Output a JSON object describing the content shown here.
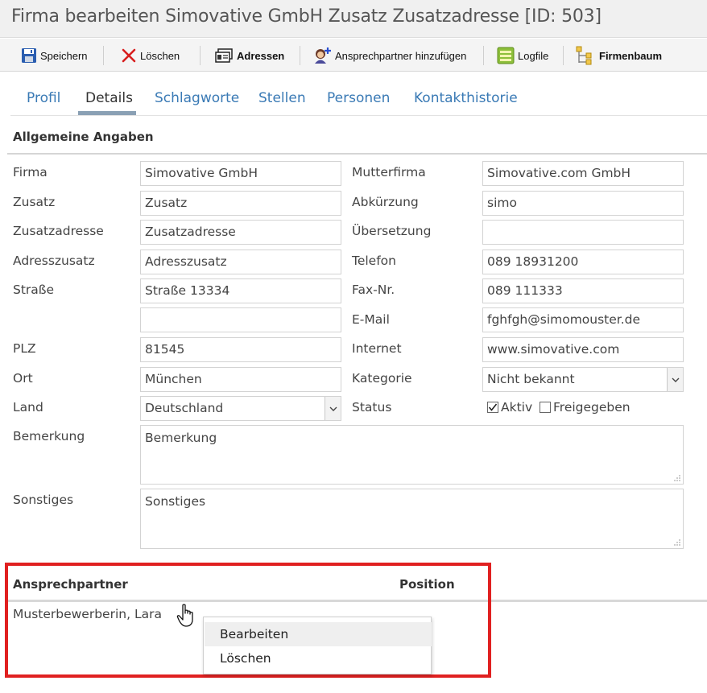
{
  "window": {
    "title": "Firma bearbeiten Simovative GmbH Zusatz Zusatzadresse [ID: 503]"
  },
  "toolbar": {
    "save": {
      "label": "Speichern",
      "icon": "floppy-disk-icon"
    },
    "delete": {
      "label": "Löschen",
      "icon": "red-x-icon"
    },
    "addresses": {
      "label": "Adressen",
      "icon": "address-cards-icon"
    },
    "add_contact": {
      "label": "Ansprechpartner hinzufügen",
      "icon": "add-person-icon"
    },
    "logfile": {
      "label": "Logfile",
      "icon": "list-icon"
    },
    "company_tree": {
      "label": "Firmenbaum",
      "icon": "tree-icon"
    }
  },
  "tabs": [
    {
      "label": "Profil",
      "active": false
    },
    {
      "label": "Details",
      "active": true
    },
    {
      "label": "Schlagworte",
      "active": false
    },
    {
      "label": "Stellen",
      "active": false
    },
    {
      "label": "Personen",
      "active": false
    },
    {
      "label": "Kontakthistorie",
      "active": false
    }
  ],
  "section": {
    "title": "Allgemeine Angaben"
  },
  "form": {
    "firma": {
      "label": "Firma",
      "value": "Simovative GmbH"
    },
    "zusatz": {
      "label": "Zusatz",
      "value": "Zusatz"
    },
    "zusatzadresse": {
      "label": "Zusatzadresse",
      "value": "Zusatzadresse"
    },
    "adresszusatz": {
      "label": "Adresszusatz",
      "value": "Adresszusatz"
    },
    "strasse": {
      "label": "Straße",
      "value": "Straße 13334"
    },
    "strasse2": {
      "label": "",
      "value": ""
    },
    "plz": {
      "label": "PLZ",
      "value": "81545"
    },
    "ort": {
      "label": "Ort",
      "value": "München"
    },
    "land": {
      "label": "Land",
      "value": "Deutschland"
    },
    "bemerkung": {
      "label": "Bemerkung",
      "value": "Bemerkung"
    },
    "sonstiges": {
      "label": "Sonstiges",
      "value": "Sonstiges"
    },
    "mutterfirma": {
      "label": "Mutterfirma",
      "value": "Simovative.com GmbH"
    },
    "abkuerzung": {
      "label": "Abkürzung",
      "value": "simo"
    },
    "uebersetzung": {
      "label": "Übersetzung",
      "value": ""
    },
    "telefon": {
      "label": "Telefon",
      "value": "089 18931200"
    },
    "fax": {
      "label": "Fax-Nr.",
      "value": "089 111333"
    },
    "email": {
      "label": "E-Mail",
      "value": "fghfgh@simomouster.de"
    },
    "internet": {
      "label": "Internet",
      "value": "www.simovative.com"
    },
    "kategorie": {
      "label": "Kategorie",
      "value": "Nicht bekannt"
    },
    "status": {
      "label": "Status",
      "aktiv": {
        "label": "Aktiv",
        "checked": true
      },
      "freigegeben": {
        "label": "Freigegeben",
        "checked": false
      }
    }
  },
  "contacts": {
    "columns": {
      "name": "Ansprechpartner",
      "position": "Position"
    },
    "rows": [
      {
        "name": "Musterbewerberin, Lara",
        "position": ""
      }
    ]
  },
  "context_menu": {
    "items": [
      {
        "label": "Bearbeiten",
        "hovered": true
      },
      {
        "label": "Löschen",
        "hovered": false
      }
    ]
  },
  "colors": {
    "link": "#3a7ab5",
    "highlight": "#e02020",
    "tab_underline": "#8aa0b4"
  }
}
